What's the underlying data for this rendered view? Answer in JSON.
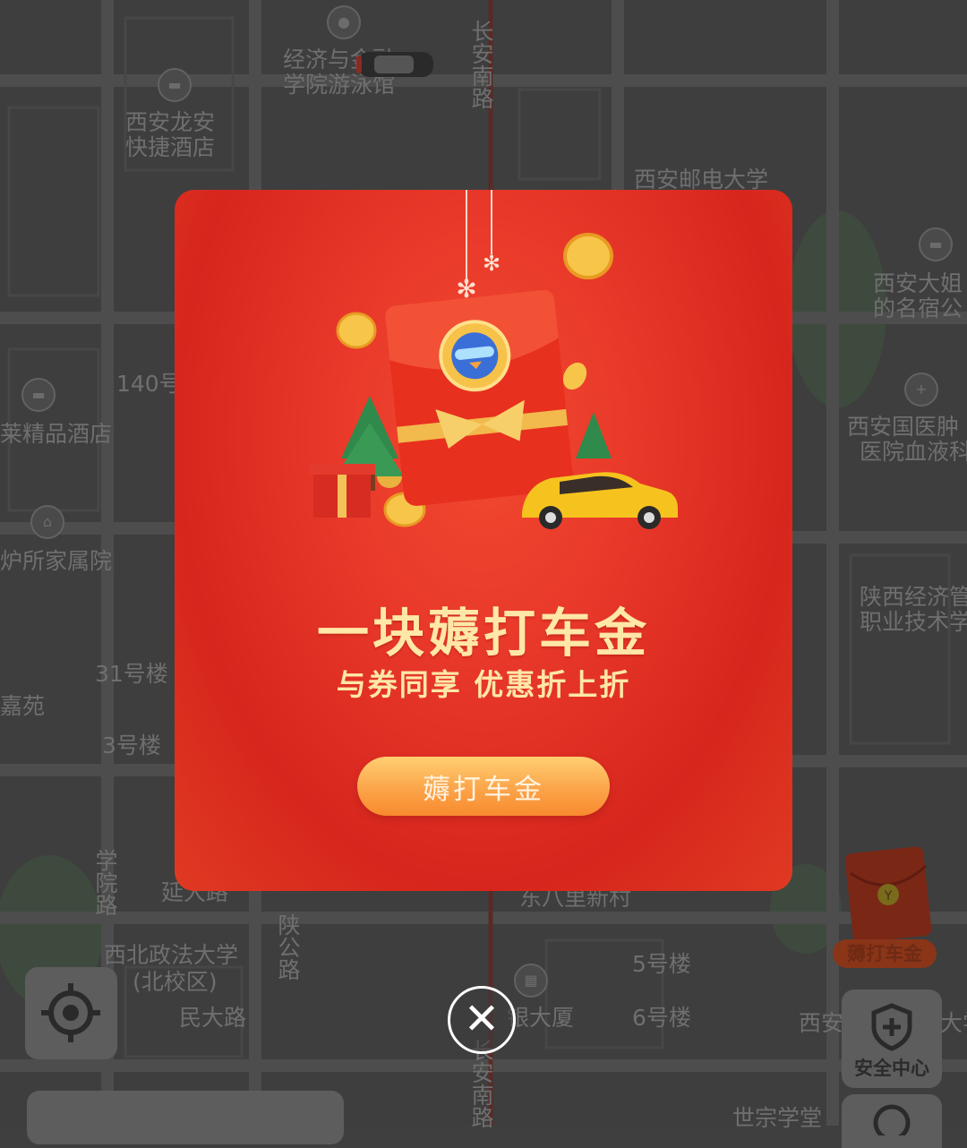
{
  "map": {
    "labels": [
      {
        "id": "l1",
        "text": "经济与金融"
      },
      {
        "id": "l1b",
        "text": "学院游泳馆"
      },
      {
        "id": "l2",
        "text": "西安龙安"
      },
      {
        "id": "l2b",
        "text": "快捷酒店"
      },
      {
        "id": "l3",
        "text": "长安南路"
      },
      {
        "id": "l4",
        "text": "西安邮电大学"
      },
      {
        "id": "l5",
        "text": "西安大姐"
      },
      {
        "id": "l5b",
        "text": "的名宿公"
      },
      {
        "id": "l6",
        "text": "140号"
      },
      {
        "id": "l7",
        "text": "莱精品酒店"
      },
      {
        "id": "l8",
        "text": "西安国医肿"
      },
      {
        "id": "l8b",
        "text": "医院血液科"
      },
      {
        "id": "l9",
        "text": "炉所家属院"
      },
      {
        "id": "l10",
        "text": "陕西经济管"
      },
      {
        "id": "l10b",
        "text": "职业技术学"
      },
      {
        "id": "l11",
        "text": "31号楼"
      },
      {
        "id": "l12",
        "text": "嘉苑"
      },
      {
        "id": "l13",
        "text": "3号楼"
      },
      {
        "id": "l14",
        "text": "学院路"
      },
      {
        "id": "l15",
        "text": "延大路"
      },
      {
        "id": "l16",
        "text": "东八里新村"
      },
      {
        "id": "l17",
        "text": "陕公路"
      },
      {
        "id": "l18",
        "text": "西北政法大学"
      },
      {
        "id": "l18b",
        "text": "(北校区)"
      },
      {
        "id": "l19",
        "text": "5号楼"
      },
      {
        "id": "l20",
        "text": "民大路"
      },
      {
        "id": "l21",
        "text": "银大厦"
      },
      {
        "id": "l22",
        "text": "6号楼"
      },
      {
        "id": "l23",
        "text": "西安"
      },
      {
        "id": "l24",
        "text": "大学"
      },
      {
        "id": "l25",
        "text": "世宗学堂"
      },
      {
        "id": "l26",
        "text": "长安南路"
      }
    ]
  },
  "popup": {
    "title": "一块薅打车金",
    "subtitle": "与券同享 优惠折上折",
    "cta_label": "薅打车金"
  },
  "floating_envelope": {
    "label": "薅打车金"
  },
  "safety": {
    "label": "安全中心"
  },
  "close": {
    "glyph": "✕"
  },
  "colors": {
    "popup_red": "#e8382a",
    "headline_gold": "#ffe7a8",
    "cta_orange": "#fca44a"
  }
}
